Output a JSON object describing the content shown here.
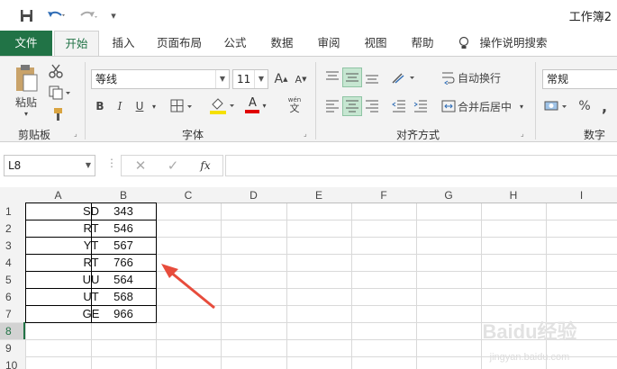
{
  "title": "工作簿2",
  "quick_access": {
    "save": "save-icon",
    "undo": "undo-icon",
    "redo": "redo-icon",
    "customize": "▾"
  },
  "tabs": [
    "文件",
    "开始",
    "插入",
    "页面布局",
    "公式",
    "数据",
    "审阅",
    "视图",
    "帮助",
    "操作说明搜索"
  ],
  "ribbon": {
    "clipboard": {
      "paste_label": "粘贴",
      "group_label": "剪贴板"
    },
    "font": {
      "font_name": "等线",
      "font_size": "11",
      "group_label": "字体",
      "bold": "B",
      "italic": "I",
      "underline": "U",
      "font_color": "A",
      "grow": "A",
      "shrink": "A",
      "phonetic_top": "wén",
      "phonetic_bottom": "文"
    },
    "alignment": {
      "wrap_label": "自动换行",
      "merge_label": "合并后居中",
      "group_label": "对齐方式"
    },
    "number": {
      "format": "常规",
      "percent": "%",
      "comma": ",",
      "group_label": "数字"
    }
  },
  "formula_bar": {
    "name_box": "L8",
    "fx": "fx",
    "value": ""
  },
  "columns": [
    "A",
    "B",
    "C",
    "D",
    "E",
    "F",
    "G",
    "H",
    "I"
  ],
  "rows": [
    {
      "num": "1",
      "a": "SD",
      "b": "343"
    },
    {
      "num": "2",
      "a": "RT",
      "b": "546"
    },
    {
      "num": "3",
      "a": "YT",
      "b": "567"
    },
    {
      "num": "4",
      "a": "RT",
      "b": "766"
    },
    {
      "num": "5",
      "a": "UU",
      "b": "564"
    },
    {
      "num": "6",
      "a": "UT",
      "b": "568"
    },
    {
      "num": "7",
      "a": "GE",
      "b": "966"
    },
    {
      "num": "8",
      "a": "",
      "b": ""
    },
    {
      "num": "9",
      "a": "",
      "b": ""
    },
    {
      "num": "10",
      "a": "",
      "b": ""
    }
  ],
  "active_row": "8",
  "watermark": "Baidu经验 jingyan.baidu.com",
  "colors": {
    "accent": "#217346",
    "arrow": "#e74c3c"
  }
}
